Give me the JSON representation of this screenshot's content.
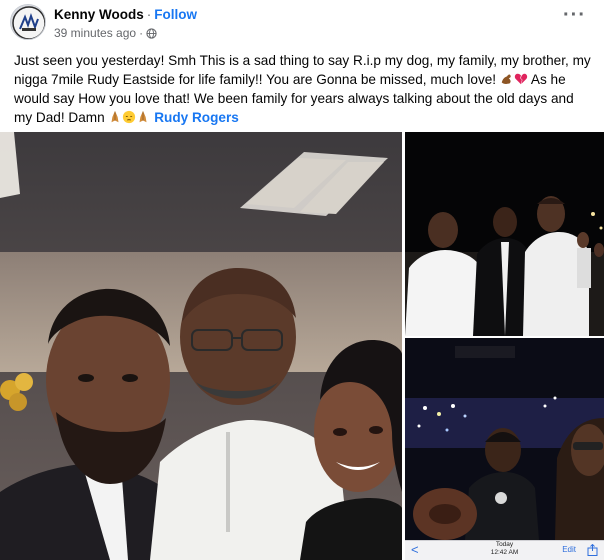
{
  "post": {
    "author": "Kenny Woods",
    "separator": "·",
    "follow_label": "Follow",
    "timestamp": "39 minutes ago",
    "meta_separator": "·",
    "audience_icon": "globe-icon",
    "more_icon": "more-options-icon",
    "text_part1": "Just seen you yesterday! Smh This is a sad thing to say R.i.p my dog, my family, my brother, my nigga 7mile Rudy Eastside for life family!! You are Gonna be missed, much love! ",
    "text_part2": " As he would say How you love that! We been family for years always talking about the old days and my Dad! Damn ",
    "tagged_person": "Rudy Rogers"
  },
  "photos": {
    "main": "photo-main",
    "top_right": "photo-top-right",
    "bottom_right": "photo-bottom-right",
    "phone_ui": {
      "back_glyph": "<",
      "date_top": "Today",
      "time": "12:42 AM",
      "edit_label": "Edit"
    }
  },
  "colors": {
    "link": "#1877f2",
    "secondary_text": "#65676b"
  }
}
